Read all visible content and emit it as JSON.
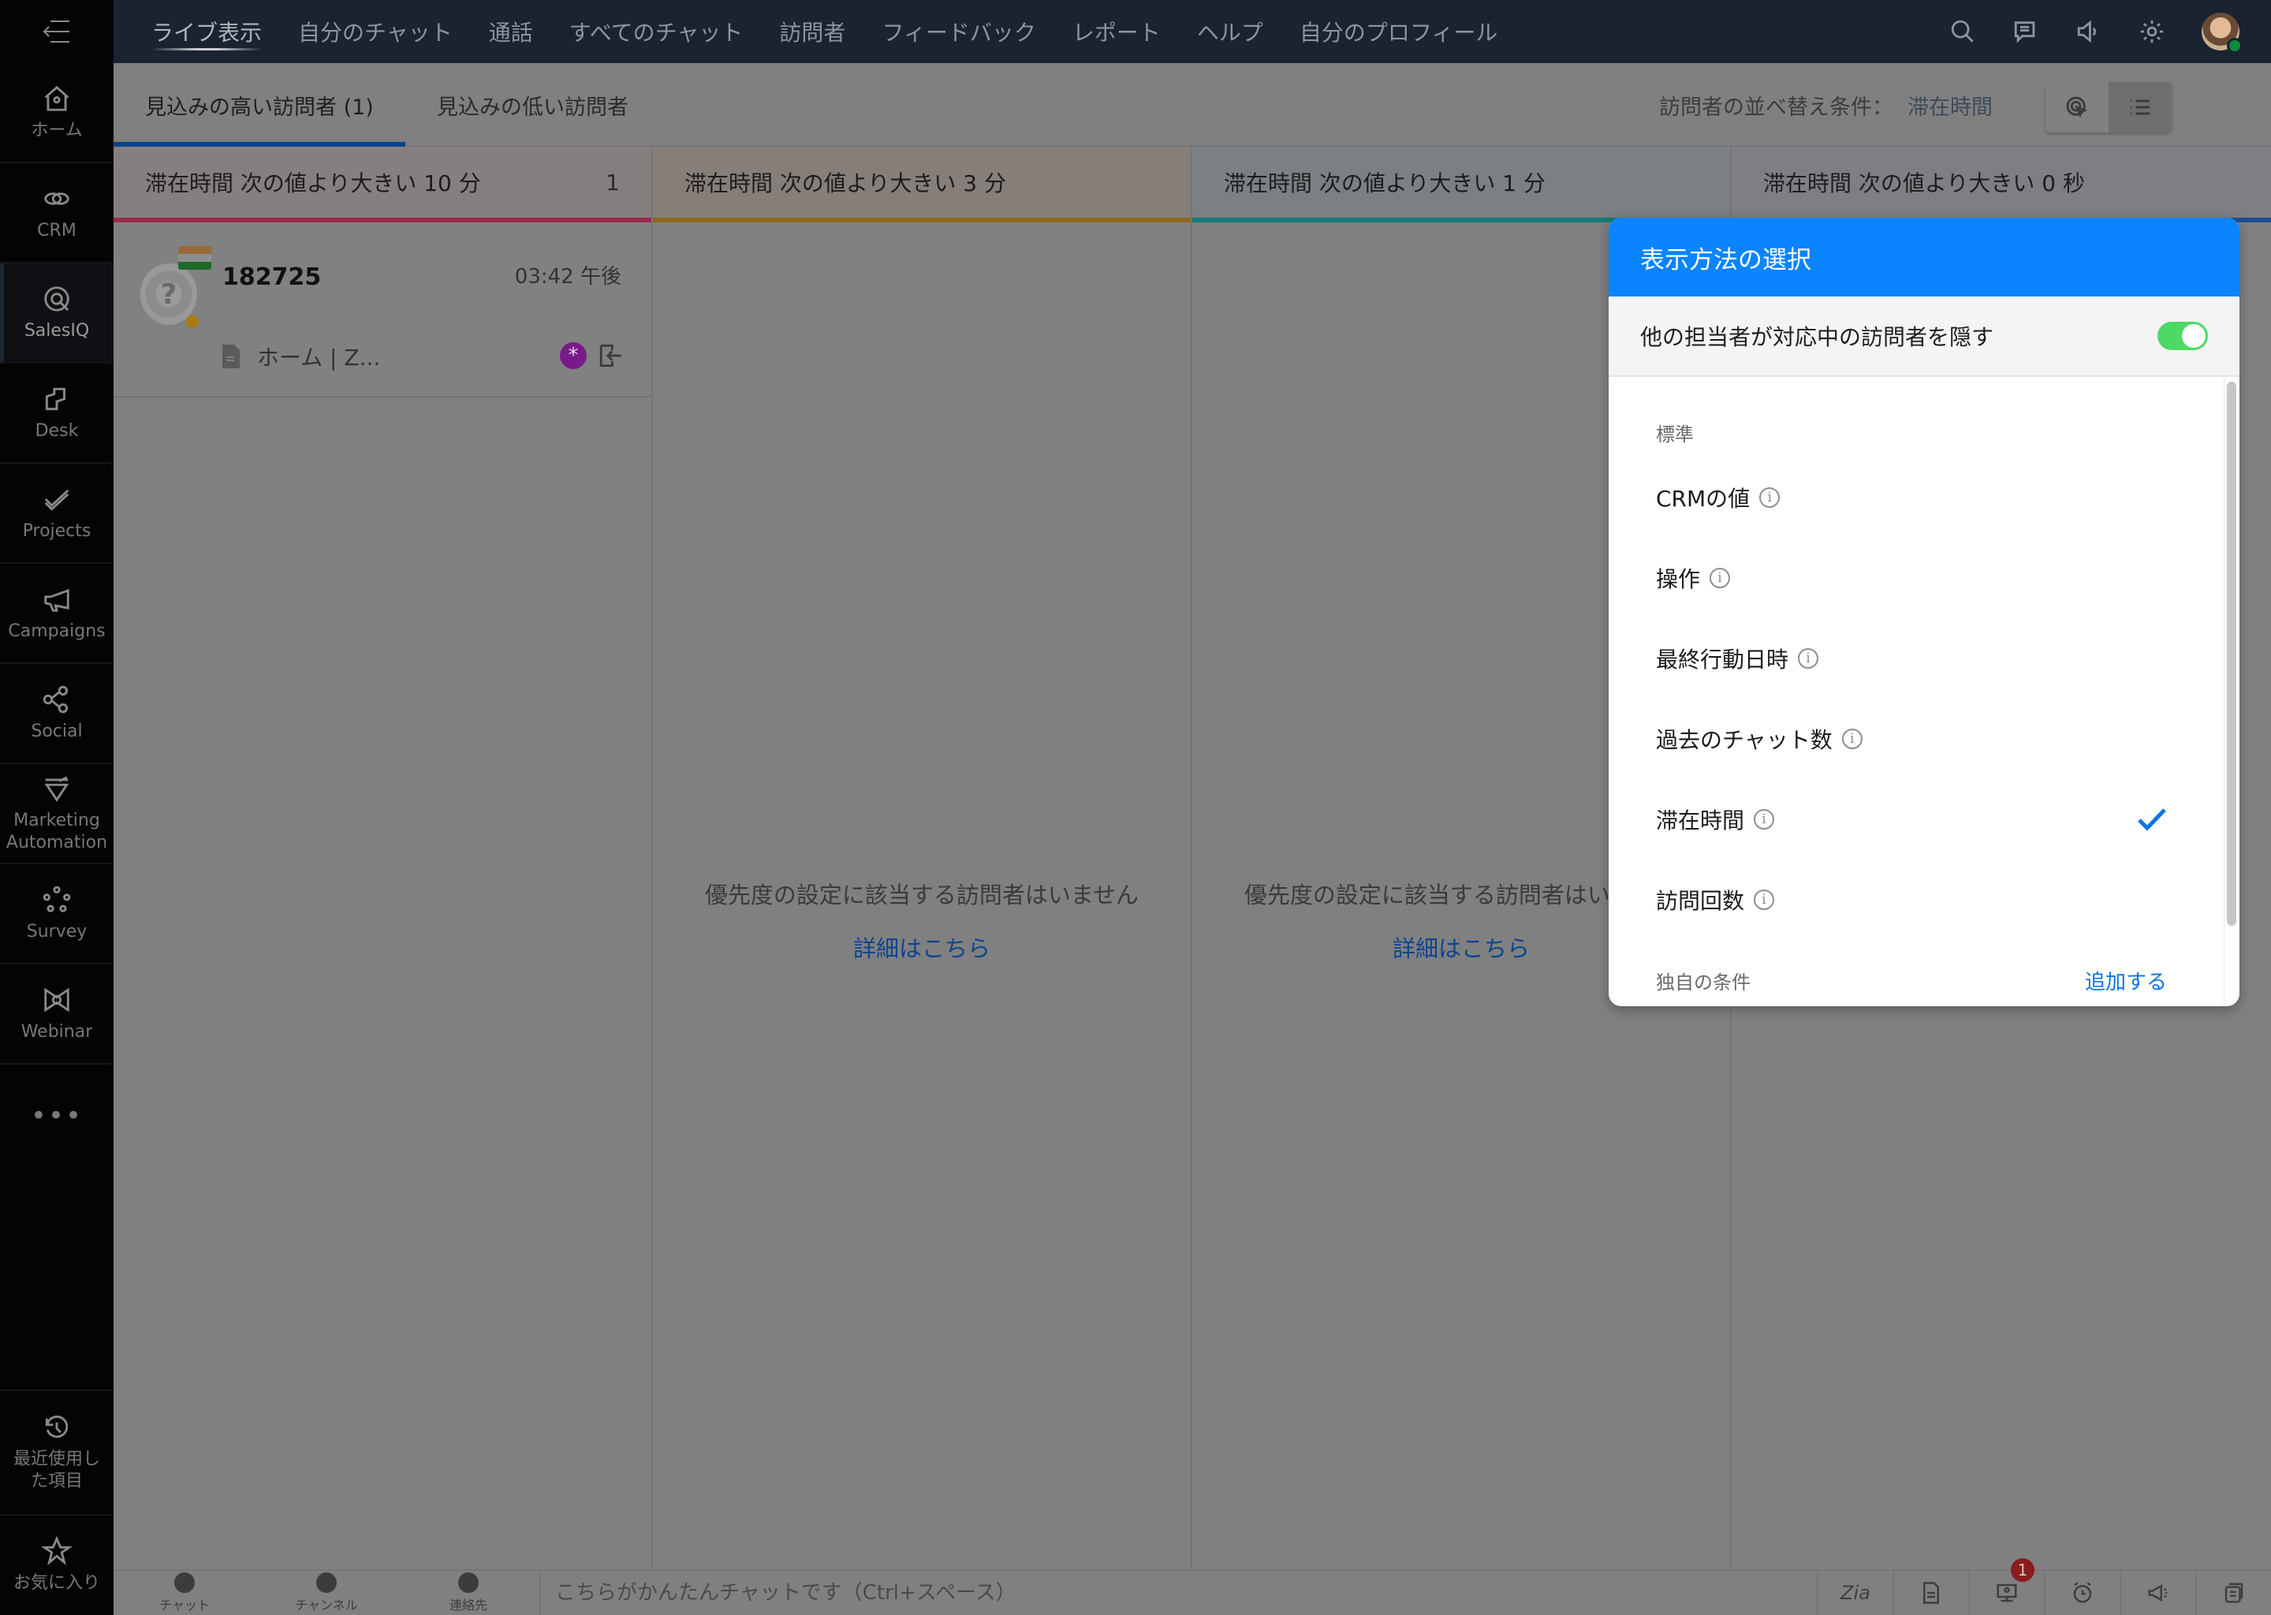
{
  "sidebar": {
    "menu_icon": "menu-collapse-icon",
    "items": [
      {
        "label": "ホーム",
        "icon": "home-icon",
        "active": false
      },
      {
        "label": "CRM",
        "icon": "crm-icon",
        "active": false
      },
      {
        "label": "SalesIQ",
        "icon": "salesiq-icon",
        "active": true
      },
      {
        "label": "Desk",
        "icon": "desk-icon",
        "active": false
      },
      {
        "label": "Projects",
        "icon": "projects-icon",
        "active": false
      },
      {
        "label": "Campaigns",
        "icon": "campaigns-icon",
        "active": false
      },
      {
        "label": "Social",
        "icon": "social-icon",
        "active": false
      },
      {
        "label": "Marketing Automation",
        "icon": "marketing-automation-icon",
        "active": false
      },
      {
        "label": "Survey",
        "icon": "survey-icon",
        "active": false
      },
      {
        "label": "Webinar",
        "icon": "webinar-icon",
        "active": false
      }
    ],
    "more": "•••",
    "recent_label": "最近使用した項目",
    "favorites_label": "お気に入り"
  },
  "topnav": {
    "tabs": [
      "ライブ表示",
      "自分のチャット",
      "通話",
      "すべてのチャット",
      "訪問者",
      "フィードバック",
      "レポート",
      "ヘルプ",
      "自分のプロフィール"
    ],
    "active_tab": "ライブ表示",
    "icons": [
      "search-icon",
      "chat-bubble-icon",
      "speaker-icon",
      "gear-icon"
    ],
    "user_status": "online"
  },
  "subheader": {
    "tabs": [
      "見込みの高い訪問者 (1)",
      "見込みの低い訪問者"
    ],
    "active_tab": 0,
    "sort_label": "訪問者の並べ替え条件：",
    "sort_value": "滞在時間",
    "view_modes": [
      "ring-view",
      "list-view"
    ],
    "selected_view": "list-view"
  },
  "columns": [
    {
      "title": "滞在時間 次の値より大きい 10 分",
      "count": "1",
      "color": "#9b2a4a"
    },
    {
      "title": "滞在時間 次の値より大きい 3 分",
      "count": "",
      "color": "#8a6a1c",
      "empty_message": "優先度の設定に該当する訪問者はいません",
      "empty_link": "詳細はこちら"
    },
    {
      "title": "滞在時間 次の値より大きい 1 分",
      "count": "",
      "color": "#177a7a",
      "empty_message": "優先度の設定に該当する訪問者はいません",
      "empty_link": "詳細はこちら"
    },
    {
      "title": "滞在時間 次の値より大きい 0 秒",
      "count": "",
      "color": "#1e4f94"
    }
  ],
  "visitor": {
    "name": "182725",
    "time": "03:42 午後",
    "page": "ホーム | Z...",
    "country": "India",
    "status_color": "#a87c10"
  },
  "popup": {
    "title": "表示方法の選択",
    "hide_label": "他の担当者が対応中の訪問者を隠す",
    "hide_enabled": true,
    "section_standard": "標準",
    "options": [
      {
        "label": "CRMの値",
        "selected": false
      },
      {
        "label": "操作",
        "selected": false
      },
      {
        "label": "最終行動日時",
        "selected": false
      },
      {
        "label": "過去のチャット数",
        "selected": false
      },
      {
        "label": "滞在時間",
        "selected": true
      },
      {
        "label": "訪問回数",
        "selected": false
      }
    ],
    "section_custom": "独自の条件",
    "add_label": "追加する",
    "accent": "#0a84ff"
  },
  "bottombar": {
    "items": [
      "チャット",
      "チャンネル",
      "連絡先"
    ],
    "chat_placeholder": "こちらがかんたんチャットです（Ctrl+スペース）",
    "tools": [
      "zia-icon",
      "document-icon",
      "visitor-monitor-icon",
      "alarm-icon",
      "announcement-icon",
      "notes-icon"
    ],
    "zia_label": "Zia",
    "notification_count": "1"
  }
}
